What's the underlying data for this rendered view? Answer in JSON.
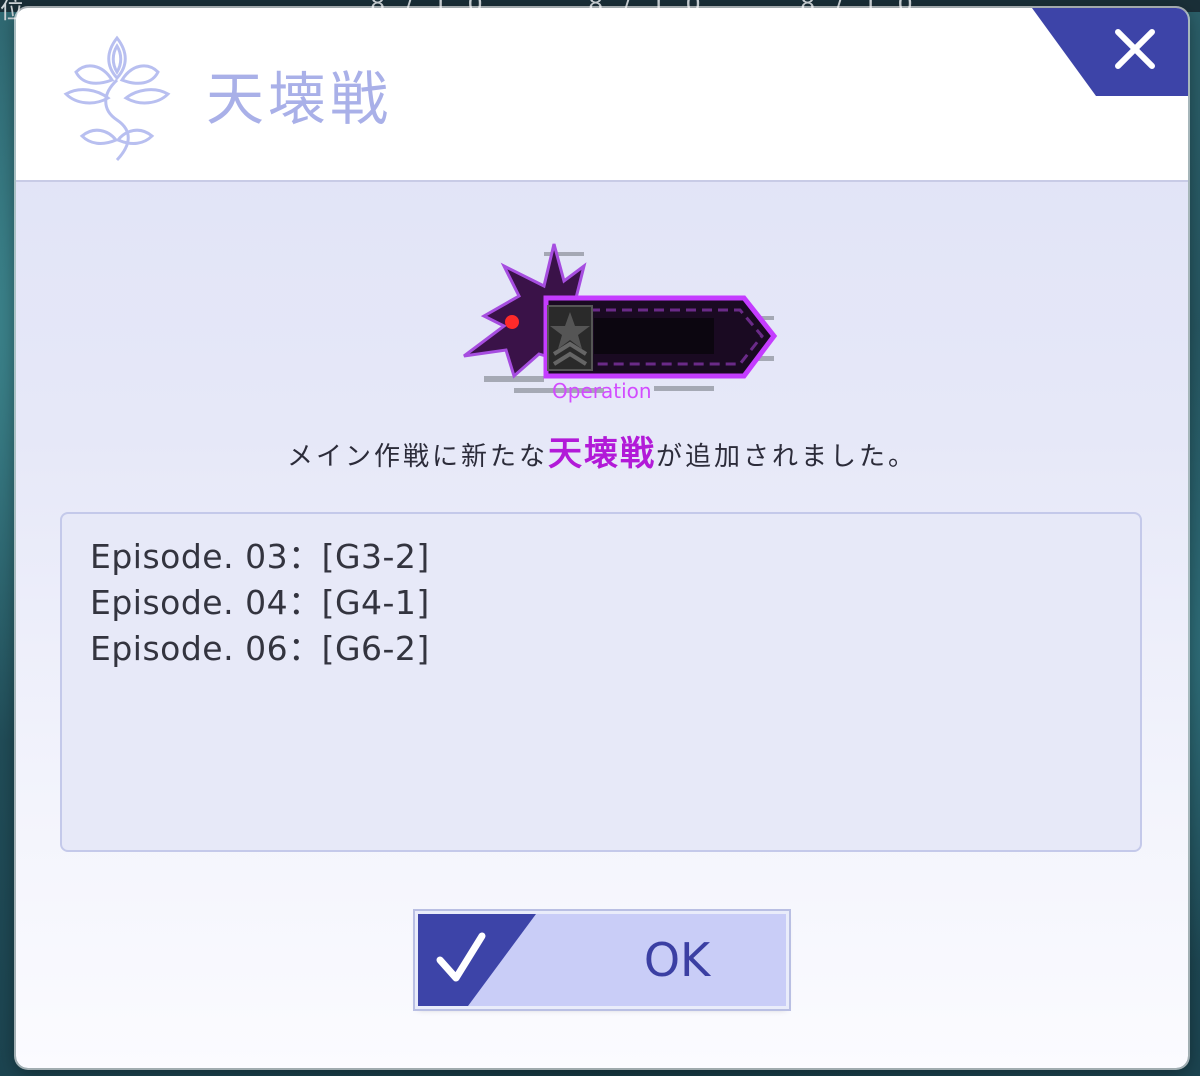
{
  "background": {
    "topbar_fragments": [
      "位",
      "8 / 1 0",
      "8 / 1 0",
      "8 / 1 0"
    ]
  },
  "dialog": {
    "title": "天壊戦",
    "close_icon": "close-icon",
    "emblem_icon": "flower-emblem-icon",
    "banner_icon": "operation-banner-icon",
    "banner_text": "Operation",
    "message": {
      "before": "メイン作戦に新たな",
      "highlight": "天壊戦",
      "after": "が追加されました。"
    },
    "episodes": [
      "Episode. 03：[G3-2]",
      "Episode. 04：[G4-1]",
      "Episode. 06：[G6-2]"
    ],
    "ok_button": {
      "label": "OK",
      "icon": "checkmark-icon"
    }
  },
  "colors": {
    "accent": "#3d44a8",
    "highlight": "#b21ad8",
    "title": "#a9b0e8"
  }
}
